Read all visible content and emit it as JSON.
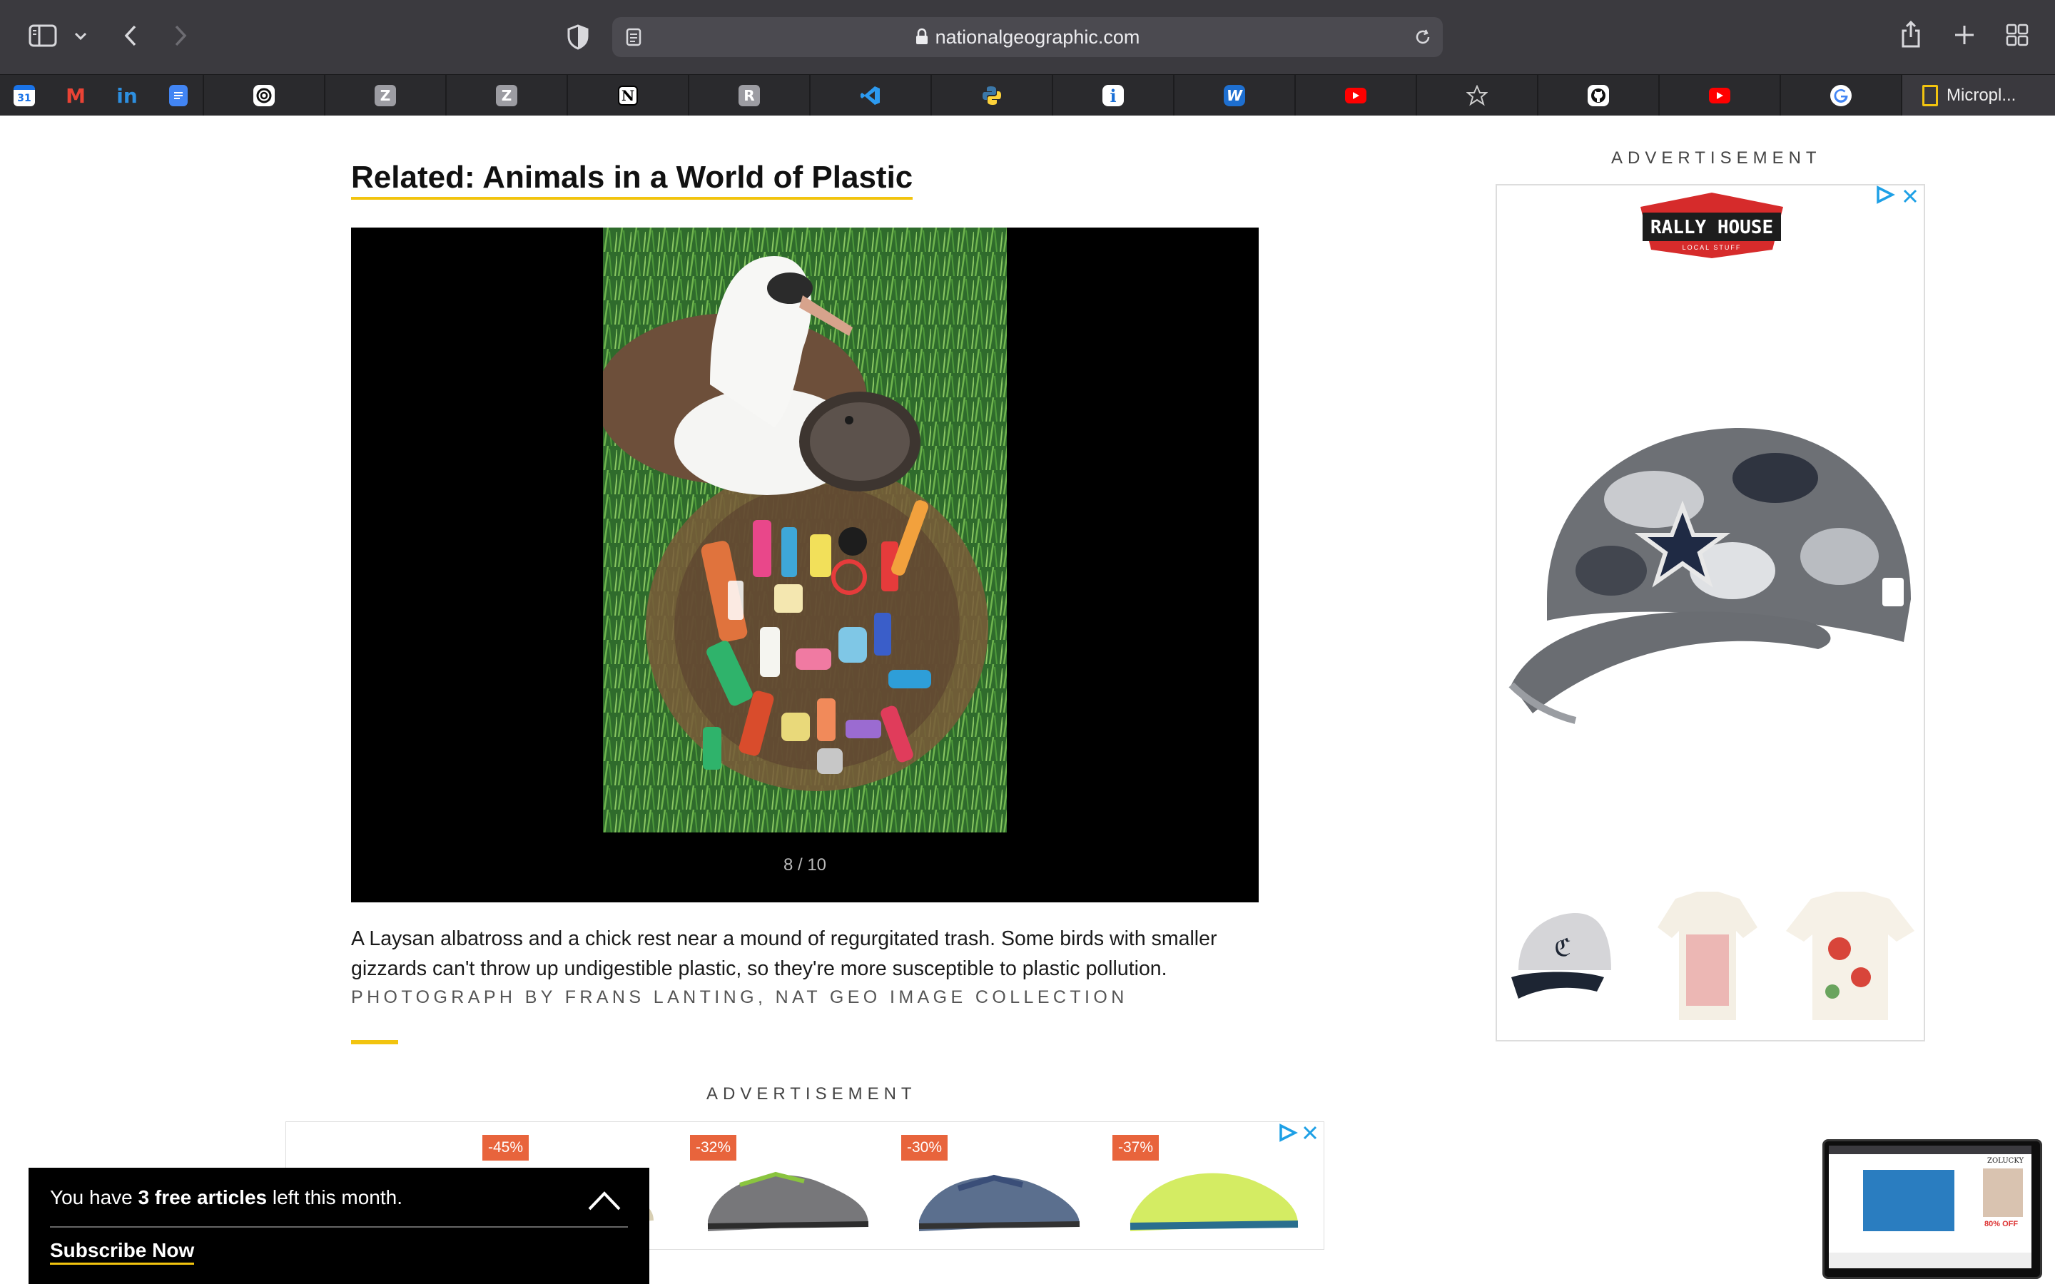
{
  "browser": {
    "url": "nationalgeographic.com",
    "toolbar_icons": [
      "sidebar-icon",
      "chevron-down-icon",
      "back-icon",
      "forward-icon",
      "shield-icon",
      "reader-icon",
      "lock-icon",
      "reload-icon",
      "share-icon",
      "new-tab-icon",
      "tab-overview-icon"
    ]
  },
  "tabs": {
    "active_label": "Micropl...",
    "favicons": [
      "calendar",
      "gmail",
      "linkedin",
      "google-docs",
      "circle-app",
      "zotero",
      "zotero",
      "notion",
      "r-app",
      "vscode",
      "python",
      "info-app",
      "wordpress",
      "youtube",
      "star",
      "github",
      "youtube",
      "google"
    ]
  },
  "article": {
    "related_title": "Related: Animals in a World of Plastic",
    "gallery_counter": "8 / 10",
    "caption": "A Laysan albatross and a chick rest near a mound of regurgitated trash. Some birds with smaller gizzards can't throw up undigestible plastic, so they're more susceptible to plastic pollution.",
    "credit": "PHOTOGRAPH BY FRANS LANTING, NAT GEO IMAGE COLLECTION"
  },
  "ads": {
    "label": "ADVERTISEMENT",
    "right_brand": "RALLY HOUSE",
    "right_brand_sub": "LOCAL STUFF",
    "discounts": [
      "-45%",
      "-32%",
      "-30%",
      "-37%"
    ]
  },
  "subscribe": {
    "text_before": "You have ",
    "count_text": "3 free articles",
    "text_after": " left this month.",
    "link": "Subscribe Now"
  },
  "pip": {
    "brand": "ZOLUCKY",
    "offer": "80% OFF"
  },
  "colors": {
    "accent_yellow": "#f2c40f",
    "toolbar": "#3b3a3f",
    "tabbar": "#2a2a2d",
    "discount_badge": "#e8643c"
  }
}
